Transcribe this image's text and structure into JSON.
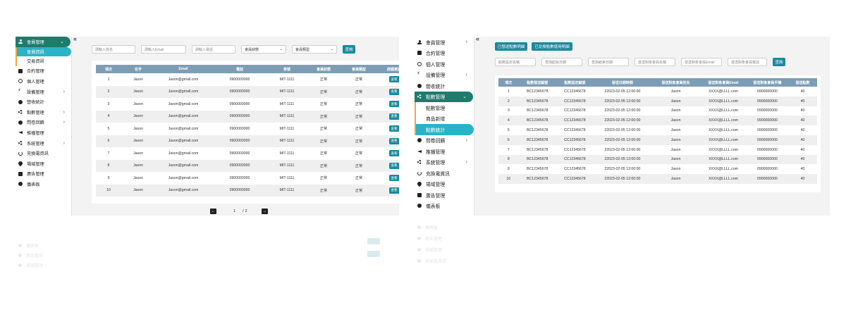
{
  "left": {
    "collapse_label": "«",
    "nav_top": {
      "label": "會員管理",
      "chevron": "⌄"
    },
    "nav_subs": [
      {
        "label": "會員資訊",
        "selected": true
      },
      {
        "label": "交易資訊",
        "selected": false
      }
    ],
    "nav": [
      {
        "label": "合約管理",
        "icon": "doc-icon",
        "chevron": ""
      },
      {
        "label": "個人管理",
        "icon": "user-circle-icon",
        "chevron": ""
      },
      {
        "label": "設備管理",
        "icon": "bolt-icon",
        "chevron": "›"
      },
      {
        "label": "營收統計",
        "icon": "chart-icon",
        "chevron": ""
      },
      {
        "label": "點數管理",
        "icon": "gear-icon",
        "chevron": "›"
      },
      {
        "label": "問卷回饋",
        "icon": "chat-icon",
        "chevron": "›"
      },
      {
        "label": "推播管理",
        "icon": "megaphone-icon",
        "chevron": ""
      },
      {
        "label": "系統管理",
        "icon": "gear-icon",
        "chevron": "›"
      },
      {
        "label": "充換電資訊",
        "icon": "power-icon",
        "chevron": ""
      },
      {
        "label": "場域管理",
        "icon": "pin-icon",
        "chevron": ""
      },
      {
        "label": "廣告管理",
        "icon": "ad-icon",
        "chevron": ""
      },
      {
        "label": "儀表板",
        "icon": "cloud-icon",
        "chevron": ""
      }
    ],
    "filters": {
      "name_placeholder": "請輸入姓名",
      "email_placeholder": "請輸入Email",
      "phone_placeholder": "請輸入電話",
      "status_select": "會員狀態",
      "type_select": "會員類型",
      "search_label": "查詢"
    },
    "table": {
      "headers": [
        "項次",
        "名字",
        "Email",
        "電話",
        "車號",
        "會員狀態",
        "會員類型",
        "詳細資訊"
      ],
      "rows": [
        [
          "1",
          "Jason",
          "Jason@gmail.com",
          "0900000000",
          "MIT-1111",
          "正常",
          "正常",
          "查看"
        ],
        [
          "2",
          "Jason",
          "Jason@gmail.com",
          "0900000000",
          "MIT-1111",
          "正常",
          "正常",
          "查看"
        ],
        [
          "3",
          "Jason",
          "Jason@gmail.com",
          "0900000000",
          "MIT-1111",
          "正常",
          "正常",
          "查看"
        ],
        [
          "4",
          "Jason",
          "Jason@gmail.com",
          "0900000000",
          "MIT-1111",
          "正常",
          "正常",
          "查看"
        ],
        [
          "5",
          "Jason",
          "Jason@gmail.com",
          "0900000000",
          "MIT-1111",
          "正常",
          "正常",
          "查看"
        ],
        [
          "6",
          "Jason",
          "Jason@gmail.com",
          "0900000000",
          "MIT-1111",
          "正常",
          "正常",
          "查看"
        ],
        [
          "7",
          "Jason",
          "Jason@gmail.com",
          "0900000000",
          "MIT-1111",
          "正常",
          "正常",
          "查看"
        ],
        [
          "8",
          "Jason",
          "Jason@gmail.com",
          "0900000000",
          "MIT-1111",
          "正常",
          "正常",
          "查看"
        ],
        [
          "9",
          "Jason",
          "Jason@gmail.com",
          "0900000000",
          "MIT-1111",
          "正常",
          "正常",
          "查看"
        ],
        [
          "10",
          "Jason",
          "Jason@gmail.com",
          "0900000000",
          "MIT-1111",
          "正常",
          "正常",
          "查看"
        ]
      ]
    },
    "pager": {
      "prev": "←",
      "current": "1",
      "separator": "/",
      "total": "2",
      "next": "→"
    }
  },
  "right": {
    "collapse_label": "«",
    "nav_before": [
      {
        "label": "會員管理",
        "icon": "user-icon",
        "chevron": "›"
      },
      {
        "label": "合約管理",
        "icon": "doc-icon",
        "chevron": ""
      },
      {
        "label": "個人管理",
        "icon": "user-circle-icon",
        "chevron": ""
      },
      {
        "label": "設備管理",
        "icon": "bolt-icon",
        "chevron": "›"
      },
      {
        "label": "營收統計",
        "icon": "chart-icon",
        "chevron": ""
      }
    ],
    "nav_active": {
      "label": "點數管理",
      "chevron": "⌄"
    },
    "nav_subs": [
      {
        "label": "點數管理",
        "selected": false
      },
      {
        "label": "商品新增",
        "selected": false
      },
      {
        "label": "點數統計",
        "selected": true
      }
    ],
    "nav_after": [
      {
        "label": "問卷回饋",
        "icon": "chat-icon",
        "chevron": "›"
      },
      {
        "label": "推播管理",
        "icon": "megaphone-icon",
        "chevron": ""
      },
      {
        "label": "系統管理",
        "icon": "gear-icon",
        "chevron": "›"
      },
      {
        "label": "充換電資訊",
        "icon": "power-icon",
        "chevron": ""
      },
      {
        "label": "場域管理",
        "icon": "pin-icon",
        "chevron": ""
      },
      {
        "label": "廣告管理",
        "icon": "ad-icon",
        "chevron": ""
      },
      {
        "label": "儀表板",
        "icon": "cloud-icon",
        "chevron": ""
      }
    ],
    "tabs": [
      "已發送點數明細",
      "已兌換點數使用明細"
    ],
    "filters": {
      "f1": "點數設定名稱",
      "f2": "查詢起始日期",
      "f3": "查詢結束日期",
      "f4": "發送對象會員名稱",
      "f5": "發送對象會員Email",
      "f6": "發送對象會員電話",
      "search_label": "查詢"
    },
    "table": {
      "headers": [
        "項次",
        "點數發送編號",
        "點數設定編號",
        "發送日期時間",
        "發送對象會員姓名",
        "發送對象會員Email",
        "發送對象會員手機",
        "發送點數"
      ],
      "rows": [
        [
          "1",
          "BC12345678",
          "CC12345678",
          "22023-02-05 12:00:00",
          "Jason",
          "XXXX@LLLL.com",
          "0900000000",
          "40"
        ],
        [
          "2",
          "BC12345678",
          "CC12345678",
          "22023-02-05 12:00:00",
          "Jason",
          "XXXX@LLLL.com",
          "0900000000",
          "40"
        ],
        [
          "3",
          "BC12345678",
          "CC12345678",
          "22023-02-05 12:00:00",
          "Jason",
          "XXXX@LLLL.com",
          "0900000000",
          "40"
        ],
        [
          "4",
          "BC12345678",
          "CC12345678",
          "22023-02-05 12:00:00",
          "Jason",
          "XXXX@LLLL.com",
          "0900000000",
          "40"
        ],
        [
          "5",
          "BC12345678",
          "CC12345678",
          "22023-02-05 12:00:00",
          "Jason",
          "XXXX@LLLL.com",
          "0900000000",
          "40"
        ],
        [
          "6",
          "BC12345678",
          "CC12345678",
          "22023-02-05 12:00:00",
          "Jason",
          "XXXX@LLLL.com",
          "0900000000",
          "40"
        ],
        [
          "7",
          "BC12345678",
          "CC12345678",
          "22023-02-05 12:00:00",
          "Jason",
          "XXXX@LLLL.com",
          "0900000000",
          "40"
        ],
        [
          "8",
          "BC12345678",
          "CC12345678",
          "22023-02-05 12:00:00",
          "Jason",
          "XXXX@LLLL.com",
          "0900000000",
          "40"
        ],
        [
          "9",
          "BC12345678",
          "CC12345678",
          "22023-02-05 12:00:00",
          "Jason",
          "XXXX@LLLL.com",
          "0900000000",
          "40"
        ],
        [
          "10",
          "BC12345678",
          "CC12345678",
          "22023-02-05 12:00:00",
          "Jason",
          "XXXX@LLLL.com",
          "0900000000",
          "40"
        ]
      ]
    }
  },
  "colors": {
    "nav_active": "#1d7c6c",
    "nav_selected_sub": "#2ab3c6",
    "sub_accent": "#f5a43b",
    "button": "#1a8a9d",
    "table_header": "#7d9db5"
  }
}
